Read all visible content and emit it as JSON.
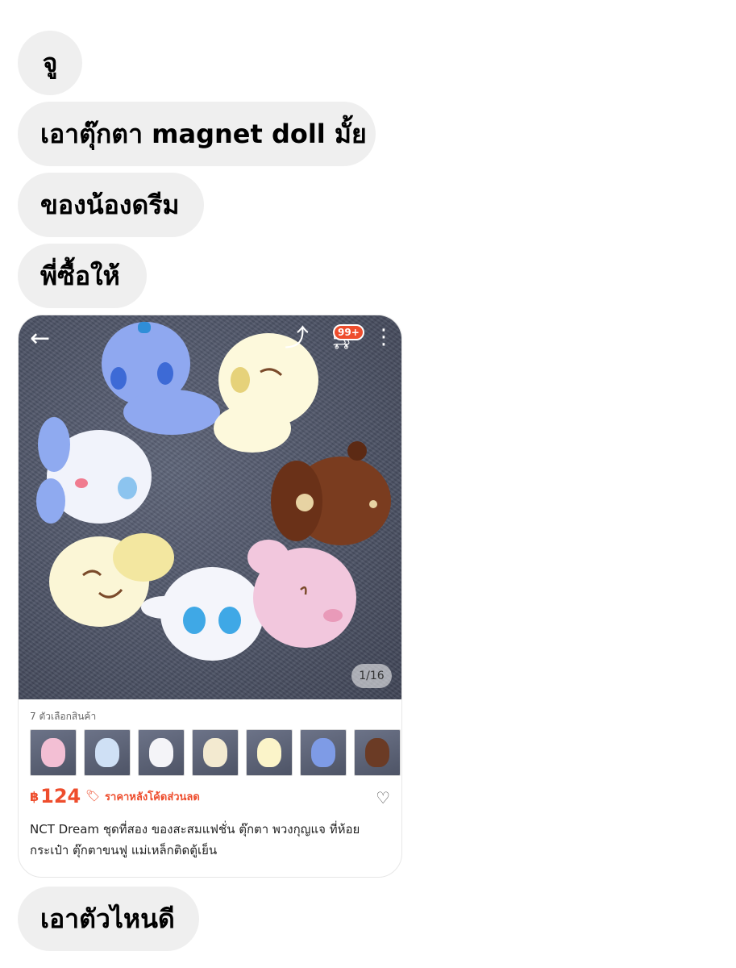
{
  "messages": [
    {
      "text": "จู"
    },
    {
      "text": "เอาตุ๊กตา magnet doll มั้ย"
    },
    {
      "text": "ของน้องดรีม"
    },
    {
      "text": "พี่ซื้อให้"
    }
  ],
  "last_message": {
    "text": "เอาตัวไหนดี"
  },
  "product": {
    "cart_badge": "99+",
    "image_counter": "1/16",
    "variants_label": "7 ตัวเลือกสินค้า",
    "variant_colors": [
      "#f3bfd4",
      "#cfe0f5",
      "#f4f4f8",
      "#f3ead0",
      "#fbf4c9",
      "#7e9be6",
      "#6b3b25"
    ],
    "currency": "฿",
    "price": "124",
    "price_note": "ราคาหลังโค้ดส่วนลด",
    "title": "NCT Dream ชุดที่สอง ของสะสมแฟชั่น ตุ๊กตา พวงกุญแจ ที่ห้อยกระเป๋า ตุ๊กตาขนฟู แม่เหล็กติดตู้เย็น",
    "accent_color": "#ee4d2d"
  }
}
